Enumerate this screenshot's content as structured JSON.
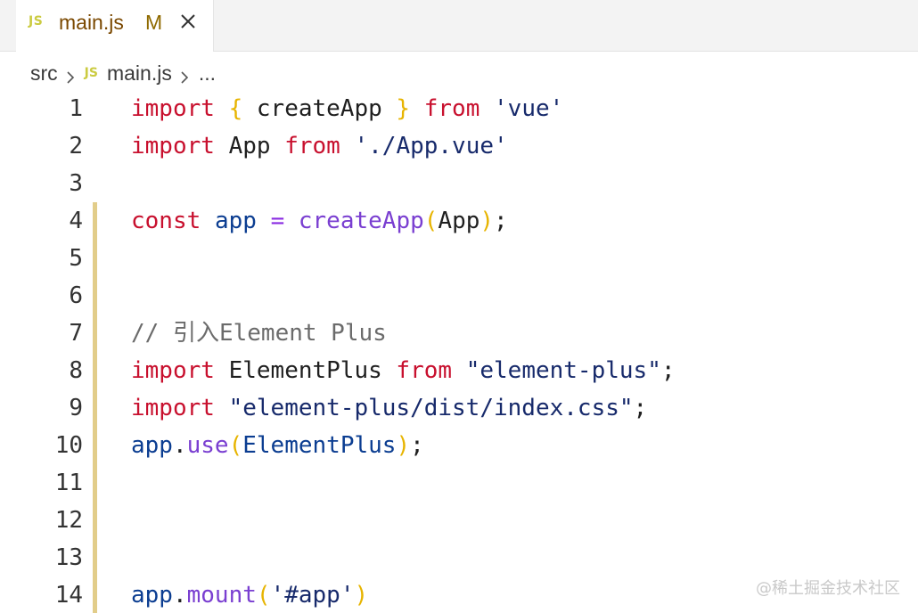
{
  "tab": {
    "lang_icon": "JS",
    "label": "main.js",
    "status": "M",
    "close_icon": "close-icon"
  },
  "breadcrumb": {
    "items": [
      "src",
      "main.js",
      "..."
    ],
    "lang_icon": "JS",
    "separator_icon": "chevron-right-icon"
  },
  "editor": {
    "line_numbers": [
      "1",
      "2",
      "3",
      "4",
      "5",
      "6",
      "7",
      "8",
      "9",
      "10",
      "11",
      "12",
      "13",
      "14"
    ],
    "lines": [
      [
        {
          "t": "import",
          "k": "keyword"
        },
        {
          "t": " ",
          "k": "punct"
        },
        {
          "t": "{",
          "k": "brace"
        },
        {
          "t": " createApp ",
          "k": "ident"
        },
        {
          "t": "}",
          "k": "brace"
        },
        {
          "t": " ",
          "k": "punct"
        },
        {
          "t": "from",
          "k": "keyword"
        },
        {
          "t": " ",
          "k": "punct"
        },
        {
          "t": "'vue'",
          "k": "string"
        }
      ],
      [
        {
          "t": "import",
          "k": "keyword"
        },
        {
          "t": " App ",
          "k": "ident"
        },
        {
          "t": "from",
          "k": "keyword"
        },
        {
          "t": " ",
          "k": "punct"
        },
        {
          "t": "'./App.vue'",
          "k": "string"
        }
      ],
      [],
      [
        {
          "t": "const",
          "k": "keyword"
        },
        {
          "t": " ",
          "k": "punct"
        },
        {
          "t": "app",
          "k": "variable"
        },
        {
          "t": " ",
          "k": "punct"
        },
        {
          "t": "=",
          "k": "operator"
        },
        {
          "t": " ",
          "k": "punct"
        },
        {
          "t": "createApp",
          "k": "func"
        },
        {
          "t": "(",
          "k": "paren"
        },
        {
          "t": "App",
          "k": "ident"
        },
        {
          "t": ")",
          "k": "paren"
        },
        {
          "t": ";",
          "k": "punct"
        }
      ],
      [],
      [],
      [
        {
          "t": "// 引入Element Plus",
          "k": "comment"
        }
      ],
      [
        {
          "t": "import",
          "k": "keyword"
        },
        {
          "t": " ElementPlus ",
          "k": "ident"
        },
        {
          "t": "from",
          "k": "keyword"
        },
        {
          "t": " ",
          "k": "punct"
        },
        {
          "t": "\"element-plus\"",
          "k": "string"
        },
        {
          "t": ";",
          "k": "punct"
        }
      ],
      [
        {
          "t": "import",
          "k": "keyword"
        },
        {
          "t": " ",
          "k": "punct"
        },
        {
          "t": "\"element-plus/dist/index.css\"",
          "k": "string"
        },
        {
          "t": ";",
          "k": "punct"
        }
      ],
      [
        {
          "t": "app",
          "k": "variable"
        },
        {
          "t": ".",
          "k": "punct"
        },
        {
          "t": "use",
          "k": "func"
        },
        {
          "t": "(",
          "k": "paren"
        },
        {
          "t": "ElementPlus",
          "k": "class"
        },
        {
          "t": ")",
          "k": "paren"
        },
        {
          "t": ";",
          "k": "punct"
        }
      ],
      [],
      [],
      [],
      [
        {
          "t": "app",
          "k": "variable"
        },
        {
          "t": ".",
          "k": "punct"
        },
        {
          "t": "mount",
          "k": "func"
        },
        {
          "t": "(",
          "k": "paren"
        },
        {
          "t": "'#app'",
          "k": "string"
        },
        {
          "t": ")",
          "k": "paren"
        }
      ]
    ],
    "modified_line_range": [
      4,
      14
    ],
    "change_marker_color": "#e2cd8a"
  },
  "watermark": {
    "text": "@稀土掘金技术社区"
  }
}
